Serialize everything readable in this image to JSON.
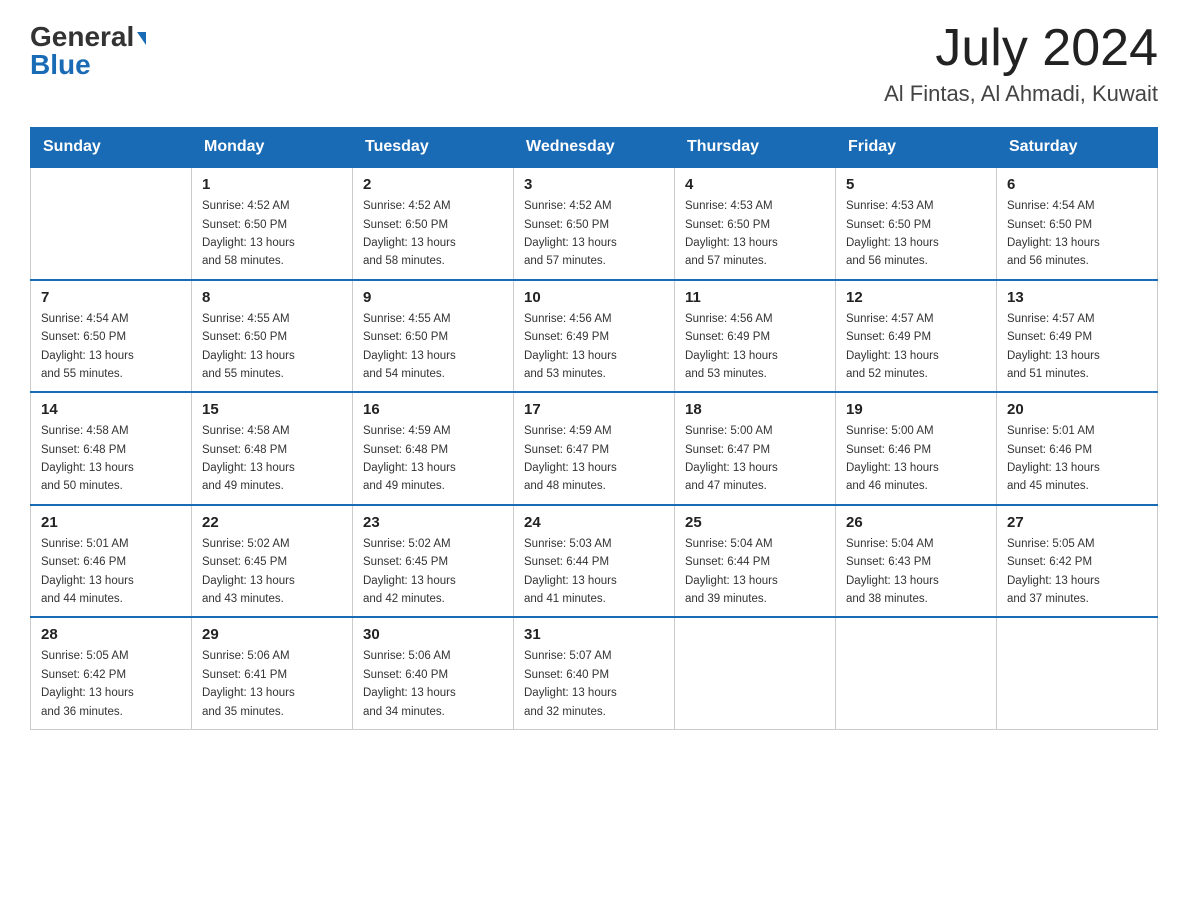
{
  "header": {
    "logo_general": "General",
    "logo_blue": "Blue",
    "month_title": "July 2024",
    "location": "Al Fintas, Al Ahmadi, Kuwait"
  },
  "days_of_week": [
    "Sunday",
    "Monday",
    "Tuesday",
    "Wednesday",
    "Thursday",
    "Friday",
    "Saturday"
  ],
  "weeks": [
    [
      {
        "day": "",
        "info": ""
      },
      {
        "day": "1",
        "info": "Sunrise: 4:52 AM\nSunset: 6:50 PM\nDaylight: 13 hours\nand 58 minutes."
      },
      {
        "day": "2",
        "info": "Sunrise: 4:52 AM\nSunset: 6:50 PM\nDaylight: 13 hours\nand 58 minutes."
      },
      {
        "day": "3",
        "info": "Sunrise: 4:52 AM\nSunset: 6:50 PM\nDaylight: 13 hours\nand 57 minutes."
      },
      {
        "day": "4",
        "info": "Sunrise: 4:53 AM\nSunset: 6:50 PM\nDaylight: 13 hours\nand 57 minutes."
      },
      {
        "day": "5",
        "info": "Sunrise: 4:53 AM\nSunset: 6:50 PM\nDaylight: 13 hours\nand 56 minutes."
      },
      {
        "day": "6",
        "info": "Sunrise: 4:54 AM\nSunset: 6:50 PM\nDaylight: 13 hours\nand 56 minutes."
      }
    ],
    [
      {
        "day": "7",
        "info": "Sunrise: 4:54 AM\nSunset: 6:50 PM\nDaylight: 13 hours\nand 55 minutes."
      },
      {
        "day": "8",
        "info": "Sunrise: 4:55 AM\nSunset: 6:50 PM\nDaylight: 13 hours\nand 55 minutes."
      },
      {
        "day": "9",
        "info": "Sunrise: 4:55 AM\nSunset: 6:50 PM\nDaylight: 13 hours\nand 54 minutes."
      },
      {
        "day": "10",
        "info": "Sunrise: 4:56 AM\nSunset: 6:49 PM\nDaylight: 13 hours\nand 53 minutes."
      },
      {
        "day": "11",
        "info": "Sunrise: 4:56 AM\nSunset: 6:49 PM\nDaylight: 13 hours\nand 53 minutes."
      },
      {
        "day": "12",
        "info": "Sunrise: 4:57 AM\nSunset: 6:49 PM\nDaylight: 13 hours\nand 52 minutes."
      },
      {
        "day": "13",
        "info": "Sunrise: 4:57 AM\nSunset: 6:49 PM\nDaylight: 13 hours\nand 51 minutes."
      }
    ],
    [
      {
        "day": "14",
        "info": "Sunrise: 4:58 AM\nSunset: 6:48 PM\nDaylight: 13 hours\nand 50 minutes."
      },
      {
        "day": "15",
        "info": "Sunrise: 4:58 AM\nSunset: 6:48 PM\nDaylight: 13 hours\nand 49 minutes."
      },
      {
        "day": "16",
        "info": "Sunrise: 4:59 AM\nSunset: 6:48 PM\nDaylight: 13 hours\nand 49 minutes."
      },
      {
        "day": "17",
        "info": "Sunrise: 4:59 AM\nSunset: 6:47 PM\nDaylight: 13 hours\nand 48 minutes."
      },
      {
        "day": "18",
        "info": "Sunrise: 5:00 AM\nSunset: 6:47 PM\nDaylight: 13 hours\nand 47 minutes."
      },
      {
        "day": "19",
        "info": "Sunrise: 5:00 AM\nSunset: 6:46 PM\nDaylight: 13 hours\nand 46 minutes."
      },
      {
        "day": "20",
        "info": "Sunrise: 5:01 AM\nSunset: 6:46 PM\nDaylight: 13 hours\nand 45 minutes."
      }
    ],
    [
      {
        "day": "21",
        "info": "Sunrise: 5:01 AM\nSunset: 6:46 PM\nDaylight: 13 hours\nand 44 minutes."
      },
      {
        "day": "22",
        "info": "Sunrise: 5:02 AM\nSunset: 6:45 PM\nDaylight: 13 hours\nand 43 minutes."
      },
      {
        "day": "23",
        "info": "Sunrise: 5:02 AM\nSunset: 6:45 PM\nDaylight: 13 hours\nand 42 minutes."
      },
      {
        "day": "24",
        "info": "Sunrise: 5:03 AM\nSunset: 6:44 PM\nDaylight: 13 hours\nand 41 minutes."
      },
      {
        "day": "25",
        "info": "Sunrise: 5:04 AM\nSunset: 6:44 PM\nDaylight: 13 hours\nand 39 minutes."
      },
      {
        "day": "26",
        "info": "Sunrise: 5:04 AM\nSunset: 6:43 PM\nDaylight: 13 hours\nand 38 minutes."
      },
      {
        "day": "27",
        "info": "Sunrise: 5:05 AM\nSunset: 6:42 PM\nDaylight: 13 hours\nand 37 minutes."
      }
    ],
    [
      {
        "day": "28",
        "info": "Sunrise: 5:05 AM\nSunset: 6:42 PM\nDaylight: 13 hours\nand 36 minutes."
      },
      {
        "day": "29",
        "info": "Sunrise: 5:06 AM\nSunset: 6:41 PM\nDaylight: 13 hours\nand 35 minutes."
      },
      {
        "day": "30",
        "info": "Sunrise: 5:06 AM\nSunset: 6:40 PM\nDaylight: 13 hours\nand 34 minutes."
      },
      {
        "day": "31",
        "info": "Sunrise: 5:07 AM\nSunset: 6:40 PM\nDaylight: 13 hours\nand 32 minutes."
      },
      {
        "day": "",
        "info": ""
      },
      {
        "day": "",
        "info": ""
      },
      {
        "day": "",
        "info": ""
      }
    ]
  ]
}
